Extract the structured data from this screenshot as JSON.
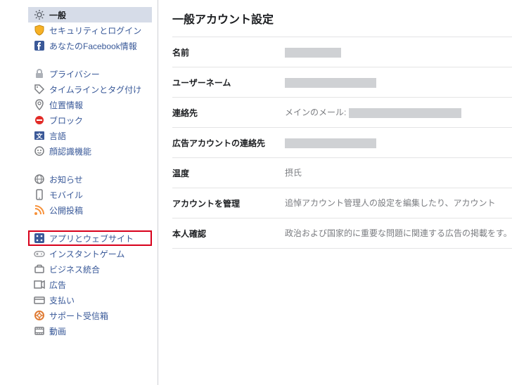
{
  "sidebar": {
    "groups": [
      [
        {
          "key": "general",
          "icon": "gear",
          "label": "一般",
          "active": true
        },
        {
          "key": "security",
          "icon": "shield",
          "label": "セキュリティとログイン"
        },
        {
          "key": "fbinfo",
          "icon": "fb",
          "label": "あなたのFacebook情報"
        }
      ],
      [
        {
          "key": "privacy",
          "icon": "lock",
          "label": "プライバシー"
        },
        {
          "key": "timeline",
          "icon": "tag",
          "label": "タイムラインとタグ付け"
        },
        {
          "key": "location",
          "icon": "location",
          "label": "位置情報"
        },
        {
          "key": "blocking",
          "icon": "block",
          "label": "ブロック"
        },
        {
          "key": "language",
          "icon": "lang",
          "label": "言語"
        },
        {
          "key": "face",
          "icon": "face",
          "label": "顔認識機能"
        }
      ],
      [
        {
          "key": "notifications",
          "icon": "globe",
          "label": "お知らせ"
        },
        {
          "key": "mobile",
          "icon": "mobile",
          "label": "モバイル"
        },
        {
          "key": "publicposts",
          "icon": "rss",
          "label": "公開投稿"
        }
      ],
      [
        {
          "key": "apps",
          "icon": "apps",
          "label": "アプリとウェブサイト",
          "highlight": true
        },
        {
          "key": "instantgames",
          "icon": "games",
          "label": "インスタントゲーム"
        },
        {
          "key": "business",
          "icon": "briefcase",
          "label": "ビジネス統合"
        },
        {
          "key": "ads",
          "icon": "ads",
          "label": "広告"
        },
        {
          "key": "payments",
          "icon": "card",
          "label": "支払い"
        },
        {
          "key": "support",
          "icon": "lifering",
          "label": "サポート受信箱"
        },
        {
          "key": "videos",
          "icon": "video",
          "label": "動画"
        }
      ]
    ]
  },
  "main": {
    "title": "一般アカウント設定",
    "rows": [
      {
        "key": "name",
        "label": "名前",
        "valueType": "redact",
        "redactClass": "w1"
      },
      {
        "key": "username",
        "label": "ユーザーネーム",
        "valueType": "redact",
        "redactClass": "w2"
      },
      {
        "key": "contact",
        "label": "連絡先",
        "valueType": "emailRedact",
        "prefix": "メインのメール:",
        "redactClass": "w3"
      },
      {
        "key": "adcontact",
        "label": "広告アカウントの連絡先",
        "valueType": "redact",
        "redactClass": "w2"
      },
      {
        "key": "temperature",
        "label": "温度",
        "valueType": "text",
        "value": "摂氏"
      },
      {
        "key": "manage",
        "label": "アカウントを管理",
        "valueType": "text",
        "value": "追悼アカウント管理人の設定を編集したり、アカウント"
      },
      {
        "key": "identity",
        "label": "本人確認",
        "valueType": "text",
        "value": "政治および国家的に重要な問題に関連する広告の掲載をす。"
      }
    ]
  }
}
